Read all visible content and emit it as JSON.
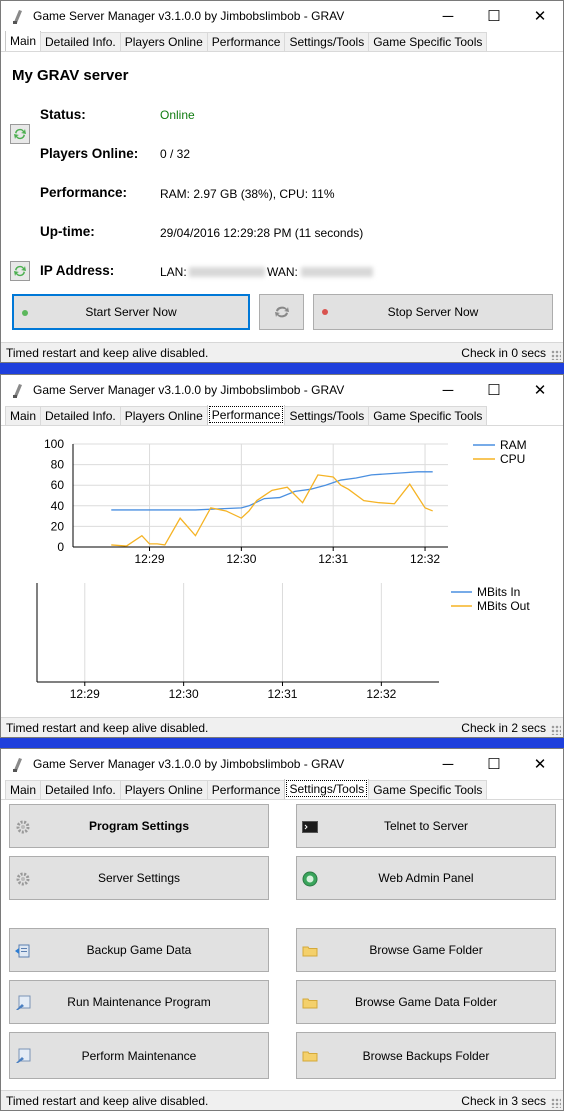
{
  "app": {
    "title": "Game Server Manager v3.1.0.0 by Jimbobslimbob - GRAV",
    "window_controls": {
      "minimize": "─",
      "maximize": "☐",
      "close": "✕"
    },
    "tabs": [
      "Main",
      "Detailed Info.",
      "Players Online",
      "Performance",
      "Settings/Tools",
      "Game Specific Tools"
    ],
    "colors": {
      "accent": "#0078d7",
      "online": "#107c10",
      "start_dot": "#5cb85c",
      "stop_dot": "#d9534f",
      "ram": "#4a8fe0",
      "cpu": "#f5b324"
    }
  },
  "main_window": {
    "active_tab": "Main",
    "server_name": "My GRAV server",
    "status_label": "Status:",
    "status_value": "Online",
    "players_label": "Players Online:",
    "players_value": "0 / 32",
    "performance_label": "Performance:",
    "performance_value": "RAM: 2.97 GB (38%), CPU: 11%",
    "uptime_label": "Up-time:",
    "uptime_value": "29/04/2016 12:29:28 PM (11 seconds)",
    "ip_label": "IP Address:",
    "lan_label": "LAN:",
    "wan_label": "WAN:",
    "start_button": "Start Server Now",
    "stop_button": "Stop Server Now",
    "statusbar_left": "Timed restart and keep alive disabled.",
    "statusbar_right": "Check in 0 secs"
  },
  "performance_window": {
    "active_tab": "Performance",
    "statusbar_left": "Timed restart and keep alive disabled.",
    "statusbar_right": "Check in 2 secs"
  },
  "chart_data": [
    {
      "type": "line",
      "title": "",
      "xlabel": "",
      "ylabel": "",
      "x_ticks": [
        "12:29",
        "12:30",
        "12:31",
        "12:32"
      ],
      "ylim": [
        0,
        100
      ],
      "y_ticks": [
        0,
        20,
        40,
        60,
        80,
        100
      ],
      "grid": true,
      "legend": "right",
      "series": [
        {
          "name": "RAM",
          "color": "#4a8fe0",
          "x": [
            "12:28:35",
            "12:29:00",
            "12:29:20",
            "12:29:30",
            "12:29:45",
            "12:30:00",
            "12:30:05",
            "12:30:15",
            "12:30:25",
            "12:30:35",
            "12:30:45",
            "12:30:55",
            "12:31:05",
            "12:31:15",
            "12:31:25",
            "12:31:35",
            "12:31:45",
            "12:31:55",
            "12:32:05"
          ],
          "values": [
            36,
            36,
            36,
            36,
            37,
            38,
            40,
            47,
            48,
            54,
            56,
            60,
            65,
            67,
            70,
            71,
            72,
            73,
            73
          ]
        },
        {
          "name": "CPU",
          "color": "#f5b324",
          "x": [
            "12:28:35",
            "12:28:45",
            "12:28:55",
            "12:29:00",
            "12:29:05",
            "12:29:10",
            "12:29:20",
            "12:29:30",
            "12:29:40",
            "12:29:50",
            "12:30:00",
            "12:30:05",
            "12:30:10",
            "12:30:20",
            "12:30:30",
            "12:30:40",
            "12:30:50",
            "12:31:00",
            "12:31:05",
            "12:31:10",
            "12:31:20",
            "12:31:30",
            "12:31:40",
            "12:31:50",
            "12:32:00",
            "12:32:05"
          ],
          "values": [
            2,
            1,
            11,
            3,
            3,
            2,
            28,
            11,
            38,
            35,
            28,
            35,
            45,
            55,
            58,
            43,
            70,
            68,
            60,
            56,
            45,
            43,
            42,
            61,
            38,
            35
          ]
        }
      ]
    },
    {
      "type": "line",
      "title": "",
      "xlabel": "",
      "ylabel": "",
      "x_ticks": [
        "12:29",
        "12:30",
        "12:31",
        "12:32"
      ],
      "grid": true,
      "legend": "right",
      "series": [
        {
          "name": "MBits In",
          "color": "#4a8fe0",
          "values": []
        },
        {
          "name": "MBits Out",
          "color": "#f5b324",
          "values": []
        }
      ]
    }
  ],
  "tools_window": {
    "active_tab": "Settings/Tools",
    "buttons_left": [
      "Program Settings",
      "Server Settings",
      "Backup Game Data",
      "Run Maintenance Program",
      "Perform Maintenance"
    ],
    "buttons_right": [
      "Telnet to Server",
      "Web Admin Panel",
      "Browse Game Folder",
      "Browse Game Data Folder",
      "Browse Backups Folder"
    ],
    "statusbar_left": "Timed restart and keep alive disabled.",
    "statusbar_right": "Check in 3 secs"
  }
}
